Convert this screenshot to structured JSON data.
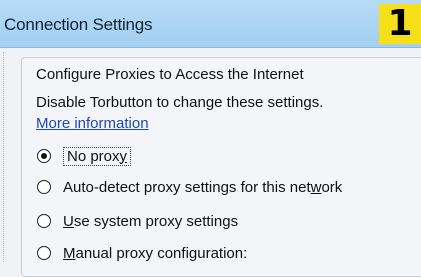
{
  "window": {
    "title": "Connection Settings",
    "badge": "1"
  },
  "panel": {
    "heading": "Configure Proxies to Access the Internet",
    "note": "Disable Torbutton to change these settings.",
    "link": "More information"
  },
  "proxy_options": [
    {
      "label_before": "No prox",
      "mnemonic": "y",
      "label_after": "",
      "selected": true
    },
    {
      "label_before": "Auto-detect proxy settings for this net",
      "mnemonic": "w",
      "label_after": "ork",
      "selected": false
    },
    {
      "label_before": "",
      "mnemonic": "U",
      "label_after": "se system proxy settings",
      "selected": false
    },
    {
      "label_before": "",
      "mnemonic": "M",
      "label_after": "anual proxy configuration:",
      "selected": false
    }
  ],
  "colors": {
    "titlebar": "#a3cff1",
    "badge": "#f5e01a",
    "link": "#1d48b8"
  }
}
